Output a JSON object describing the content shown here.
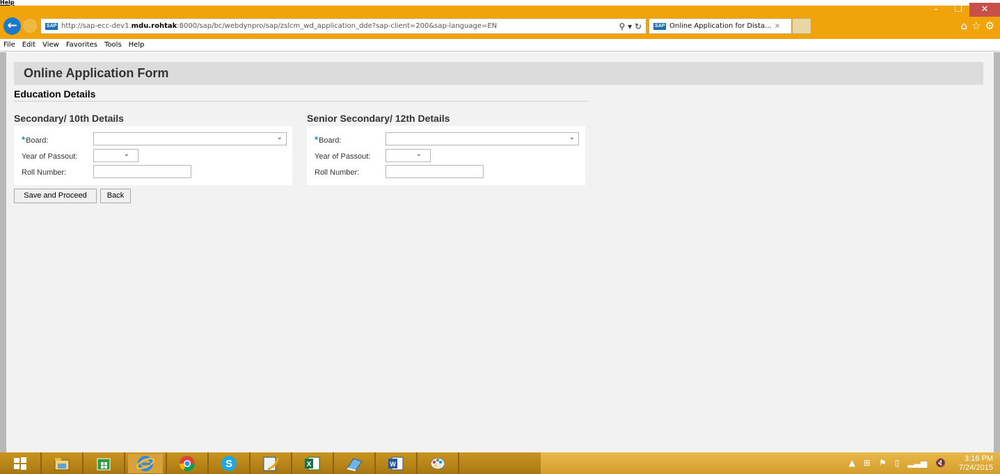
{
  "corner_text": "Help",
  "window": {
    "minimize": "–",
    "restore": "❐",
    "close": "✕"
  },
  "browser": {
    "back": "←",
    "forward": "⇨",
    "url_prefix": "http://sap-ecc-dev1.",
    "url_host": "mdu.rohtak",
    "url_rest": ":8000/sap/bc/webdynpro/sap/zslcm_wd_application_dde?sap-client=200&sap-language=EN",
    "address_tools": "⚲ ▾ ↻",
    "tab_title": "Online Application for Dista...",
    "tab_close": "×",
    "favicon_text": "SAP",
    "right_icons": [
      "⌂",
      "☆",
      "⚙"
    ],
    "menu": [
      "File",
      "Edit",
      "View",
      "Favorites",
      "Tools",
      "Help"
    ]
  },
  "form": {
    "title": "Online Application Form",
    "section": "Education Details",
    "groups": [
      {
        "title": "Secondary/ 10th Details",
        "board_label": "Board:",
        "year_label": "Year of Passout:",
        "roll_label": "Roll Number:",
        "board_value": "",
        "year_value": "",
        "roll_value": ""
      },
      {
        "title": "Senior Secondary/ 12th Details",
        "board_label": "Board:",
        "year_label": "Year of Passout:",
        "roll_label": "Roll Number:",
        "board_value": "",
        "year_value": "",
        "roll_value": ""
      }
    ],
    "required_mark": "*",
    "chevron": "⌄",
    "buttons": {
      "save": "Save and Proceed",
      "back": "Back"
    }
  },
  "taskbar": {
    "items": [
      "windows-icon",
      "file-explorer-icon",
      "store-icon",
      "internet-explorer-icon",
      "chrome-icon",
      "skype-icon",
      "notepad-icon",
      "excel-icon",
      "onenote-icon",
      "word-icon",
      "paint-icon"
    ],
    "tray_icons": [
      "▲",
      "⊞",
      "⚑",
      "▯",
      "▂▃▅",
      "🔇"
    ],
    "time": "3:16 PM",
    "date": "7/24/2015"
  },
  "colors": {
    "chrome": "#f0a30a",
    "accent_blue": "#1979ca",
    "required": "#1a8cd6"
  }
}
